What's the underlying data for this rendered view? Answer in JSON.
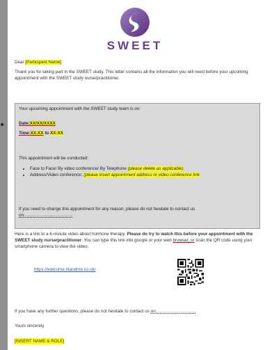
{
  "logo": {
    "text": "SWEET"
  },
  "letter": {
    "salutation": "Dear",
    "participant_name": "[Participant Name]",
    "intro": "Thank you for taking part in the SWEET study.  This letter contains all the information you will need before your upcoming appointment with the SWEET study nurse/practitioner."
  },
  "appointment": {
    "heading": "Your upcoming appointment with the SWEET study team is on:",
    "date_label": "Date:",
    "date_value": "XX/XX/XXXX",
    "time_label": "Time:",
    "time_start": "XX:XX",
    "time_sep": " to ",
    "time_end": "XX:XX",
    "conducted_heading": "This appointment will be conducted:",
    "mode_text": "Face to Face/ By video conference/ By Telephone ",
    "mode_note": "(please delete as applicable)",
    "address_text": "Address/Video conference: ",
    "address_note": "(please insert appointment address or video conference link",
    "change_text": "If you need to change this appointment for any reason, please do not hesitate to contact us",
    "change_contact": "on:……………………………"
  },
  "video": {
    "text_1": "Here is a link to a 6-minute video about hormone therapy. ",
    "text_bold": "Please do try to watch this before your appointment with the SWEET study nurse/practitioner",
    "text_2": ". You can type this link into google or your web ",
    "browser_word": "browser, or",
    "text_3": " scan the QR code using your smartphone camera to view the video.",
    "link": "https://welcome.htandme.co.uk/"
  },
  "closing": {
    "questions": "If you have any further questions, please do not hesitate to contact us ",
    "questions_contact": "on:………………………",
    "sign_off": "Yours sincerely",
    "signature": "[INSERT NAME & ROLE]"
  },
  "colors": {
    "brand": "#6b3d8f",
    "highlight": "#ffff00",
    "link": "#2f5fb0"
  }
}
